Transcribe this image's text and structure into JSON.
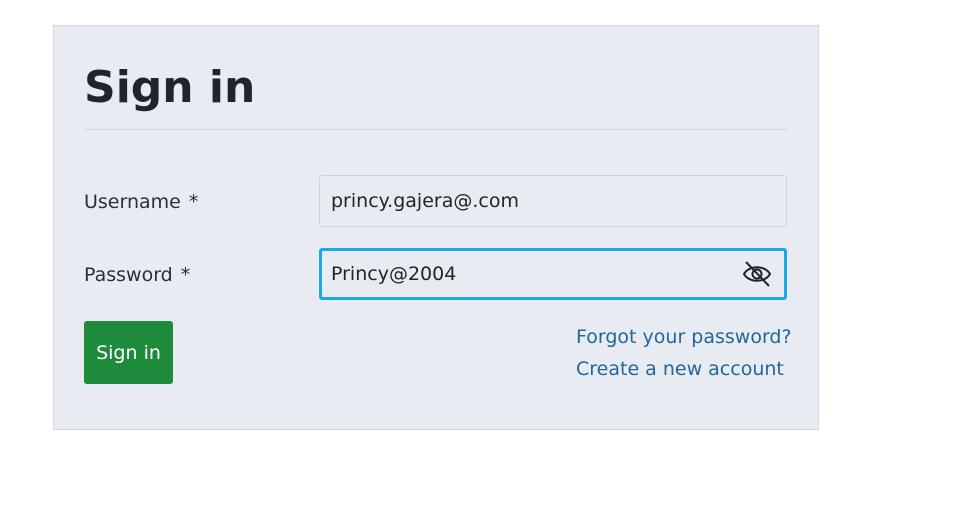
{
  "form": {
    "title": "Sign in",
    "username": {
      "label": "Username",
      "required_mark": "*",
      "value": "princy.gajera@.com"
    },
    "password": {
      "label": "Password",
      "required_mark": "*",
      "value": "Princy@2004",
      "toggle_icon": "eye-off-icon"
    },
    "submit_label": "Sign in",
    "links": {
      "forgot_password": "Forgot your password?",
      "create_account": "Create a new account"
    }
  },
  "colors": {
    "card_background": "#e8ebf2",
    "primary_button": "#1e8a3c",
    "link": "#22669a",
    "focus_border": "#1ba8e6"
  }
}
